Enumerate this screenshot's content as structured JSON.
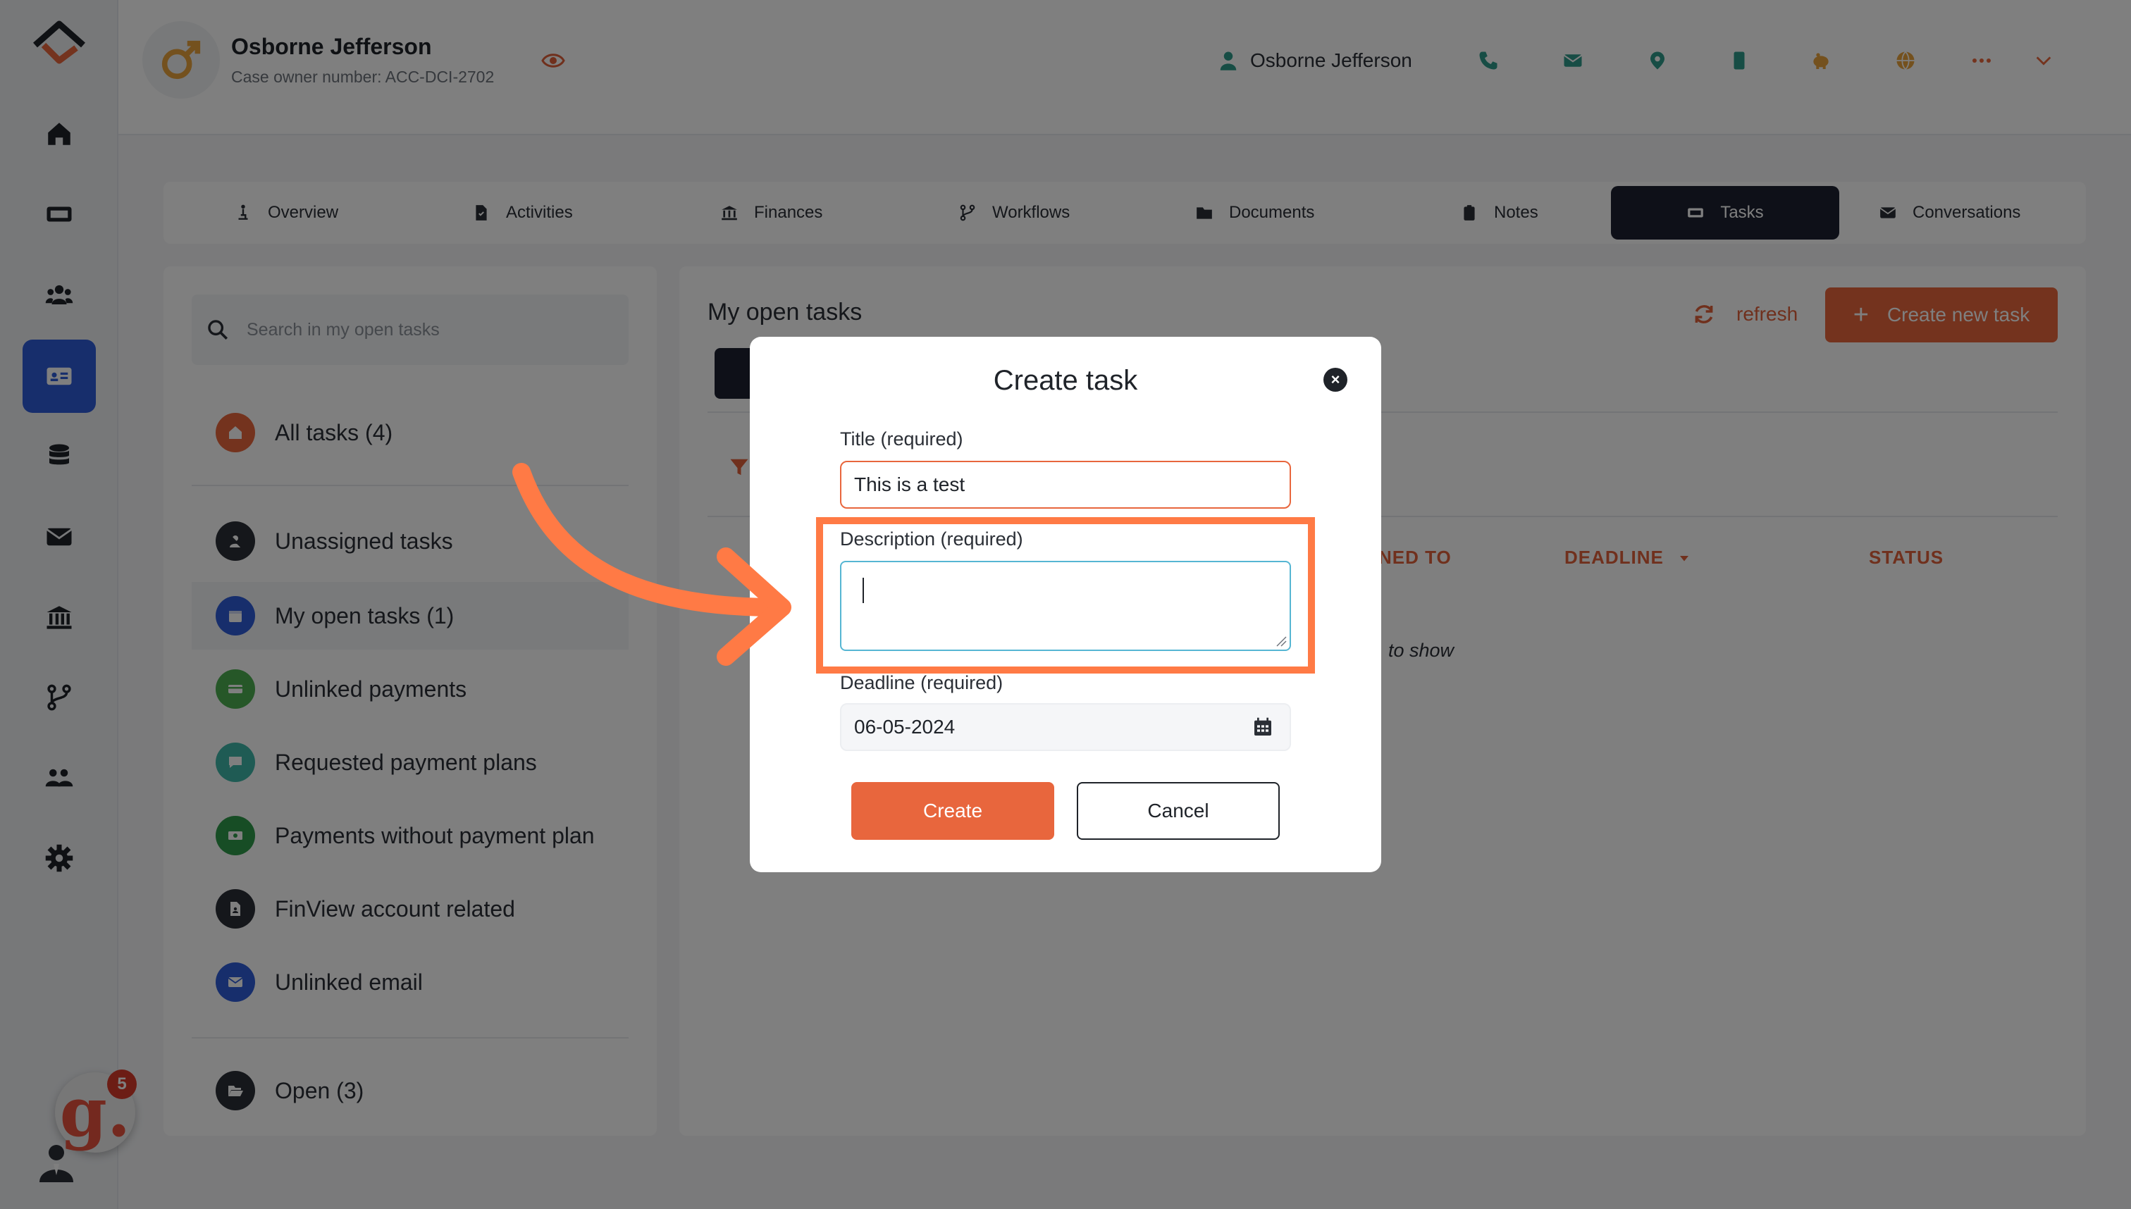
{
  "header": {
    "owner_name": "Osborne Jefferson",
    "owner_subtitle": "Case owner number: ACC-DCI-2702",
    "user_name": "Osborne Jefferson"
  },
  "tabs": [
    {
      "label": "Overview",
      "icon": "person-dolly-icon"
    },
    {
      "label": "Activities",
      "icon": "file-icon"
    },
    {
      "label": "Finances",
      "icon": "bank-icon"
    },
    {
      "label": "Workflows",
      "icon": "branch-icon"
    },
    {
      "label": "Documents",
      "icon": "folder-icon"
    },
    {
      "label": "Notes",
      "icon": "clipboard-icon"
    },
    {
      "label": "Tasks",
      "icon": "task-icon",
      "active": true
    },
    {
      "label": "Conversations",
      "icon": "envelope-icon"
    }
  ],
  "sidebar": {
    "search_placeholder": "Search in my open tasks",
    "categories": [
      {
        "label": "All tasks (4)",
        "color": "#e8663d"
      },
      {
        "label": "Unassigned tasks",
        "color": "#2b2f36"
      },
      {
        "label": "My open tasks (1)",
        "color": "#2f5dd8"
      },
      {
        "label": "Unlinked payments",
        "color": "#4caf50"
      },
      {
        "label": "Requested payment plans",
        "color": "#3fb6a8"
      },
      {
        "label": "Payments without payment plan",
        "color": "#2e9a4a"
      },
      {
        "label": "FinView account related",
        "color": "#2b2f36"
      },
      {
        "label": "Unlinked email",
        "color": "#2f5dd8"
      },
      {
        "label": "Open (3)",
        "color": "#2b2f36"
      }
    ]
  },
  "main": {
    "title": "My open tasks",
    "refresh_label": "refresh",
    "create_new_label": "Create new task",
    "columns": {
      "assigned_partial": "NED TO",
      "deadline": "DEADLINE",
      "status": "STATUS"
    },
    "empty_partial": "to show"
  },
  "modal": {
    "title": "Create task",
    "title_label": "Title (required)",
    "title_value": "This is a test",
    "description_label": "Description (required)",
    "description_value": "",
    "deadline_label": "Deadline (required)",
    "deadline_value": "06-05-2024",
    "create_label": "Create",
    "cancel_label": "Cancel"
  },
  "notifications": {
    "count": "5"
  },
  "colors": {
    "accent": "#e8663d",
    "highlight": "#ff7a45",
    "active_nav": "#2f5dd8",
    "dark": "#1c2030"
  }
}
